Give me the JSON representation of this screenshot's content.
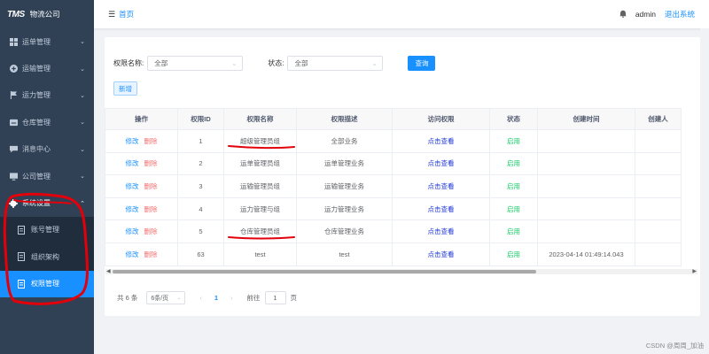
{
  "brand": {
    "logo": "TMS",
    "company": "物流公司"
  },
  "sidebar": {
    "items": [
      {
        "label": "运单管理",
        "icon": "grid-icon"
      },
      {
        "label": "运输管理",
        "icon": "plus-circle-icon"
      },
      {
        "label": "运力管理",
        "icon": "flag-icon"
      },
      {
        "label": "仓库管理",
        "icon": "warehouse-icon"
      },
      {
        "label": "消息中心",
        "icon": "message-icon"
      },
      {
        "label": "公司管理",
        "icon": "monitor-icon"
      },
      {
        "label": "系统设置",
        "icon": "gear-icon"
      }
    ],
    "subitems": [
      {
        "label": "账号管理"
      },
      {
        "label": "组织架构"
      },
      {
        "label": "权限管理"
      }
    ]
  },
  "header": {
    "breadcrumb": "首页",
    "user": "admin",
    "logout": "退出系统"
  },
  "filters": {
    "name_label": "权限名称:",
    "name_value": "全部",
    "status_label": "状态:",
    "status_value": "全部",
    "query_label": "查询",
    "add_label": "新增"
  },
  "table": {
    "columns": [
      "操作",
      "权限ID",
      "权限名称",
      "权限描述",
      "访问权限",
      "状态",
      "创建时间",
      "创建人"
    ],
    "rows": [
      {
        "edit": "修改",
        "delete": "删除",
        "id": "1",
        "name": "超级管理员组",
        "desc": "全部业务",
        "access": "点击查看",
        "status": "启用",
        "created": "",
        "creator": ""
      },
      {
        "edit": "修改",
        "delete": "删除",
        "id": "2",
        "name": "运单管理员组",
        "desc": "运单管理业务",
        "access": "点击查看",
        "status": "启用",
        "created": "",
        "creator": ""
      },
      {
        "edit": "修改",
        "delete": "删除",
        "id": "3",
        "name": "运输管理员组",
        "desc": "运输管理业务",
        "access": "点击查看",
        "status": "启用",
        "created": "",
        "creator": ""
      },
      {
        "edit": "修改",
        "delete": "删除",
        "id": "4",
        "name": "运力管理与组",
        "desc": "运力管理业务",
        "access": "点击查看",
        "status": "启用",
        "created": "",
        "creator": ""
      },
      {
        "edit": "修改",
        "delete": "删除",
        "id": "5",
        "name": "仓库管理员组",
        "desc": "仓库管理业务",
        "access": "点击查看",
        "status": "启用",
        "created": "",
        "creator": ""
      },
      {
        "edit": "修改",
        "delete": "删除",
        "id": "63",
        "name": "test",
        "desc": "test",
        "access": "点击查看",
        "status": "启用",
        "created": "2023-04-14 01:49:14.043",
        "creator": ""
      }
    ]
  },
  "pager": {
    "total": "共 6 条",
    "page_size": "6条/页",
    "current": "1",
    "goto_label": "前往",
    "goto_value": "1",
    "page_suffix": "页"
  },
  "watermark": "CSDN @周周_加油",
  "colors": {
    "sidebar": "#304156",
    "active": "#1890ff",
    "annotation": "#e3000b"
  }
}
